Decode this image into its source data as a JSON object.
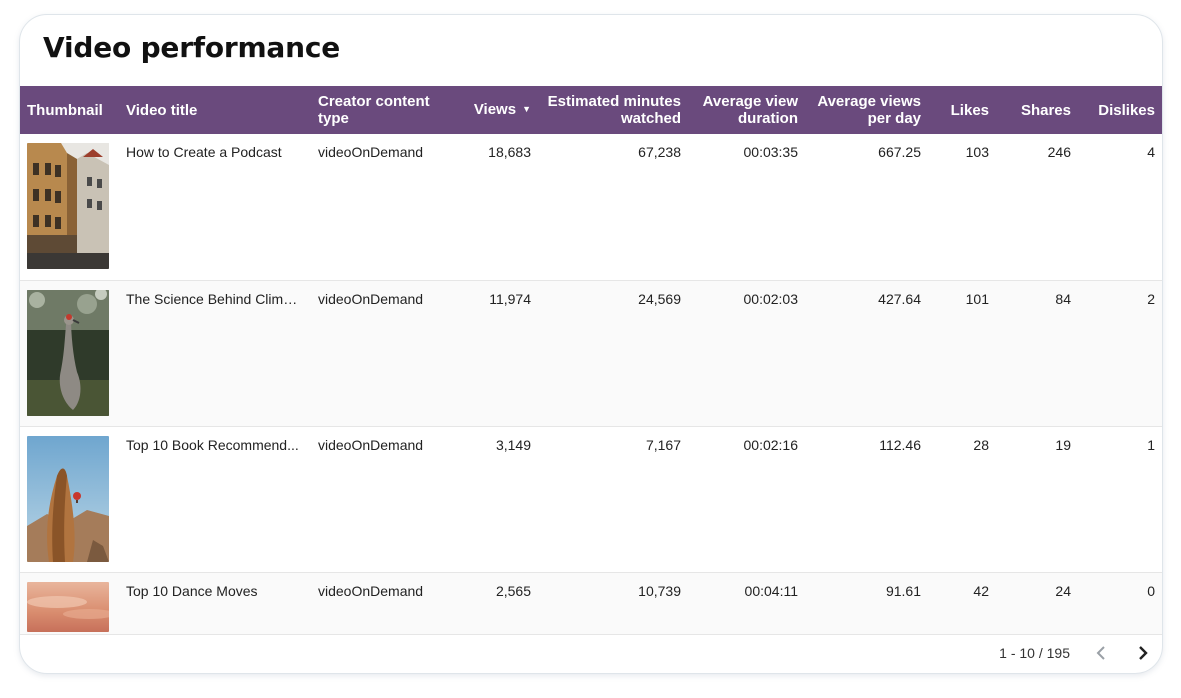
{
  "title": "Video performance",
  "columns": {
    "thumbnail": "Thumbnail",
    "video_title": "Video title",
    "creator_content_type": "Creator content type",
    "views": "Views",
    "estimated_minutes": "Estimated minutes watched",
    "avg_view_duration": "Average view duration",
    "avg_views_per_day": "Average views per day",
    "likes": "Likes",
    "shares": "Shares",
    "dislikes": "Dislikes"
  },
  "sort": {
    "column": "Views",
    "direction": "descending",
    "icon": "sort-down-icon"
  },
  "rows": [
    {
      "title": "How to Create a Podcast",
      "type": "videoOnDemand",
      "views": "18,683",
      "minutes": "67,238",
      "duration": "00:03:35",
      "per_day": "667.25",
      "likes": "103",
      "shares": "246",
      "dislikes": "4",
      "thumb": "street-buildings-photo"
    },
    {
      "title": "The Science Behind Clima...",
      "type": "videoOnDemand",
      "views": "11,974",
      "minutes": "24,569",
      "duration": "00:02:03",
      "per_day": "427.64",
      "likes": "101",
      "shares": "84",
      "dislikes": "2",
      "thumb": "crane-bird-photo"
    },
    {
      "title": "Top 10 Book Recommend...",
      "type": "videoOnDemand",
      "views": "3,149",
      "minutes": "7,167",
      "duration": "00:02:16",
      "per_day": "112.46",
      "likes": "28",
      "shares": "19",
      "dislikes": "1",
      "thumb": "rock-balloon-photo"
    },
    {
      "title": "Top 10 Dance Moves",
      "type": "videoOnDemand",
      "views": "2,565",
      "minutes": "10,739",
      "duration": "00:04:11",
      "per_day": "91.61",
      "likes": "42",
      "shares": "24",
      "dislikes": "0",
      "thumb": "sunset-sky-photo"
    }
  ],
  "pagination": {
    "range": "1 - 10 / 195",
    "prev_icon": "chevron-left-icon",
    "next_icon": "chevron-right-icon"
  },
  "colors": {
    "header_bg": "#6a4a7d",
    "header_text": "#ffffff"
  }
}
